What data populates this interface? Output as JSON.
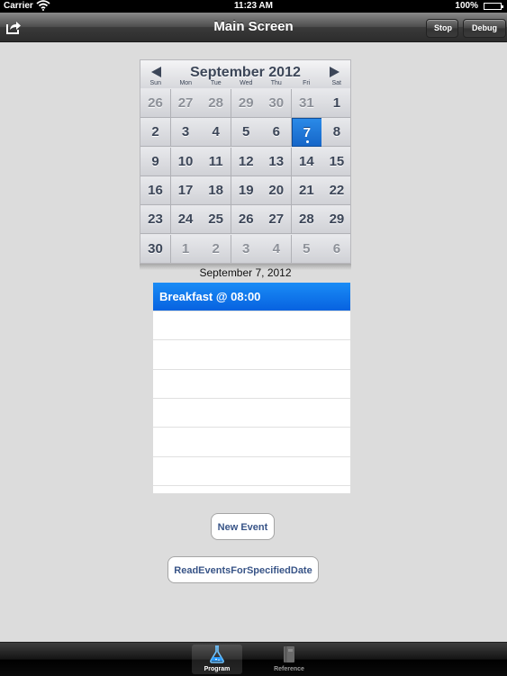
{
  "status_bar": {
    "carrier": "Carrier",
    "time": "11:23 AM",
    "battery": "100%"
  },
  "nav": {
    "title": "Main Screen",
    "stop_label": "Stop",
    "debug_label": "Debug"
  },
  "calendar": {
    "month_title": "September 2012",
    "weekdays": [
      "Sun",
      "Mon",
      "Tue",
      "Wed",
      "Thu",
      "Fri",
      "Sat"
    ],
    "weeks": [
      [
        "26",
        "27",
        "28",
        "29",
        "30",
        "31",
        "1"
      ],
      [
        "2",
        "3",
        "4",
        "5",
        "6",
        "7",
        "8"
      ],
      [
        "9",
        "10",
        "11",
        "12",
        "13",
        "14",
        "15"
      ],
      [
        "16",
        "17",
        "18",
        "19",
        "20",
        "21",
        "22"
      ],
      [
        "23",
        "24",
        "25",
        "26",
        "27",
        "28",
        "29"
      ],
      [
        "30",
        "1",
        "2",
        "3",
        "4",
        "5",
        "6"
      ]
    ],
    "selected": "7",
    "accent_color": "#1a78dc"
  },
  "events": {
    "date_header": "September 7, 2012",
    "items": [
      "Breakfast @ 08:00"
    ]
  },
  "buttons": {
    "new_event": "New Event",
    "read_events": "ReadEventsForSpecifiedDate"
  },
  "tab_bar": {
    "tabs": [
      {
        "label": "Program",
        "icon": "flask-icon"
      },
      {
        "label": "Reference",
        "icon": "book-icon"
      }
    ]
  }
}
